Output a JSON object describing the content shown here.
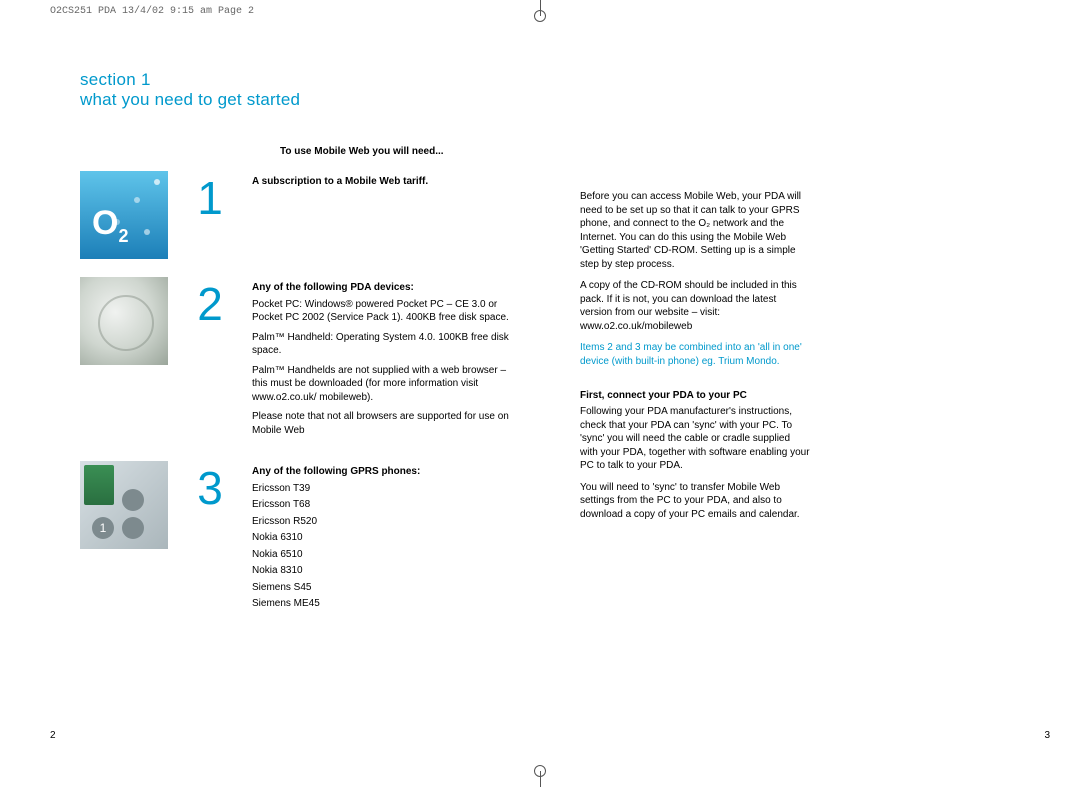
{
  "printHeader": "O2CS251 PDA  13/4/02  9:15 am  Page 2",
  "sectionLabel": "section 1",
  "sectionTitle": "what you need to get started",
  "introHeading": "To use Mobile Web you will need...",
  "items": [
    {
      "num": "1",
      "heading": "A subscription to a Mobile Web tariff."
    },
    {
      "num": "2",
      "heading": "Any of the following PDA devices:",
      "p1": "Pocket PC: Windows® powered Pocket PC – CE 3.0 or Pocket PC 2002 (Service Pack 1). 400KB free disk space.",
      "p2": "Palm™ Handheld: Operating System 4.0. 100KB free disk space.",
      "p3": "Palm™ Handhelds are not supplied with a web browser – this must be downloaded (for more information visit www.o2.co.uk/ mobileweb).",
      "p4": "Please note that not all browsers are supported for use on Mobile Web"
    },
    {
      "num": "3",
      "heading": "Any of the following GPRS phones:",
      "phones": [
        "Ericsson T39",
        "Ericsson T68",
        "Ericsson R520",
        "Nokia 6310",
        "Nokia 6510",
        "Nokia 8310",
        "Siemens S45",
        "Siemens ME45"
      ]
    }
  ],
  "right": {
    "p1": "Before you can access Mobile Web, your PDA will need to be set up so that it can talk to your GPRS phone, and connect to the O₂ network and the Internet. You can do this using the Mobile Web 'Getting Started' CD-ROM. Setting up is a simple step by step process.",
    "p2": "A copy of the CD-ROM should be included in this pack. If it is not, you can download the latest version from our website – visit: www.o2.co.uk/mobileweb",
    "note": "Items 2 and 3 may be combined into an 'all in one' device (with built-in phone) eg. Trium Mondo.",
    "h2": "First, connect your PDA to your PC",
    "p3": "Following your PDA manufacturer's instructions, check that your PDA can 'sync' with your PC. To 'sync' you will need the cable or cradle supplied with your PDA, together with software enabling your PC to talk to your PDA.",
    "p4": "You will need to 'sync' to transfer Mobile Web settings from the PC to your PDA, and also to download a copy of your PC emails and calendar."
  },
  "pageLeft": "2",
  "pageRight": "3"
}
